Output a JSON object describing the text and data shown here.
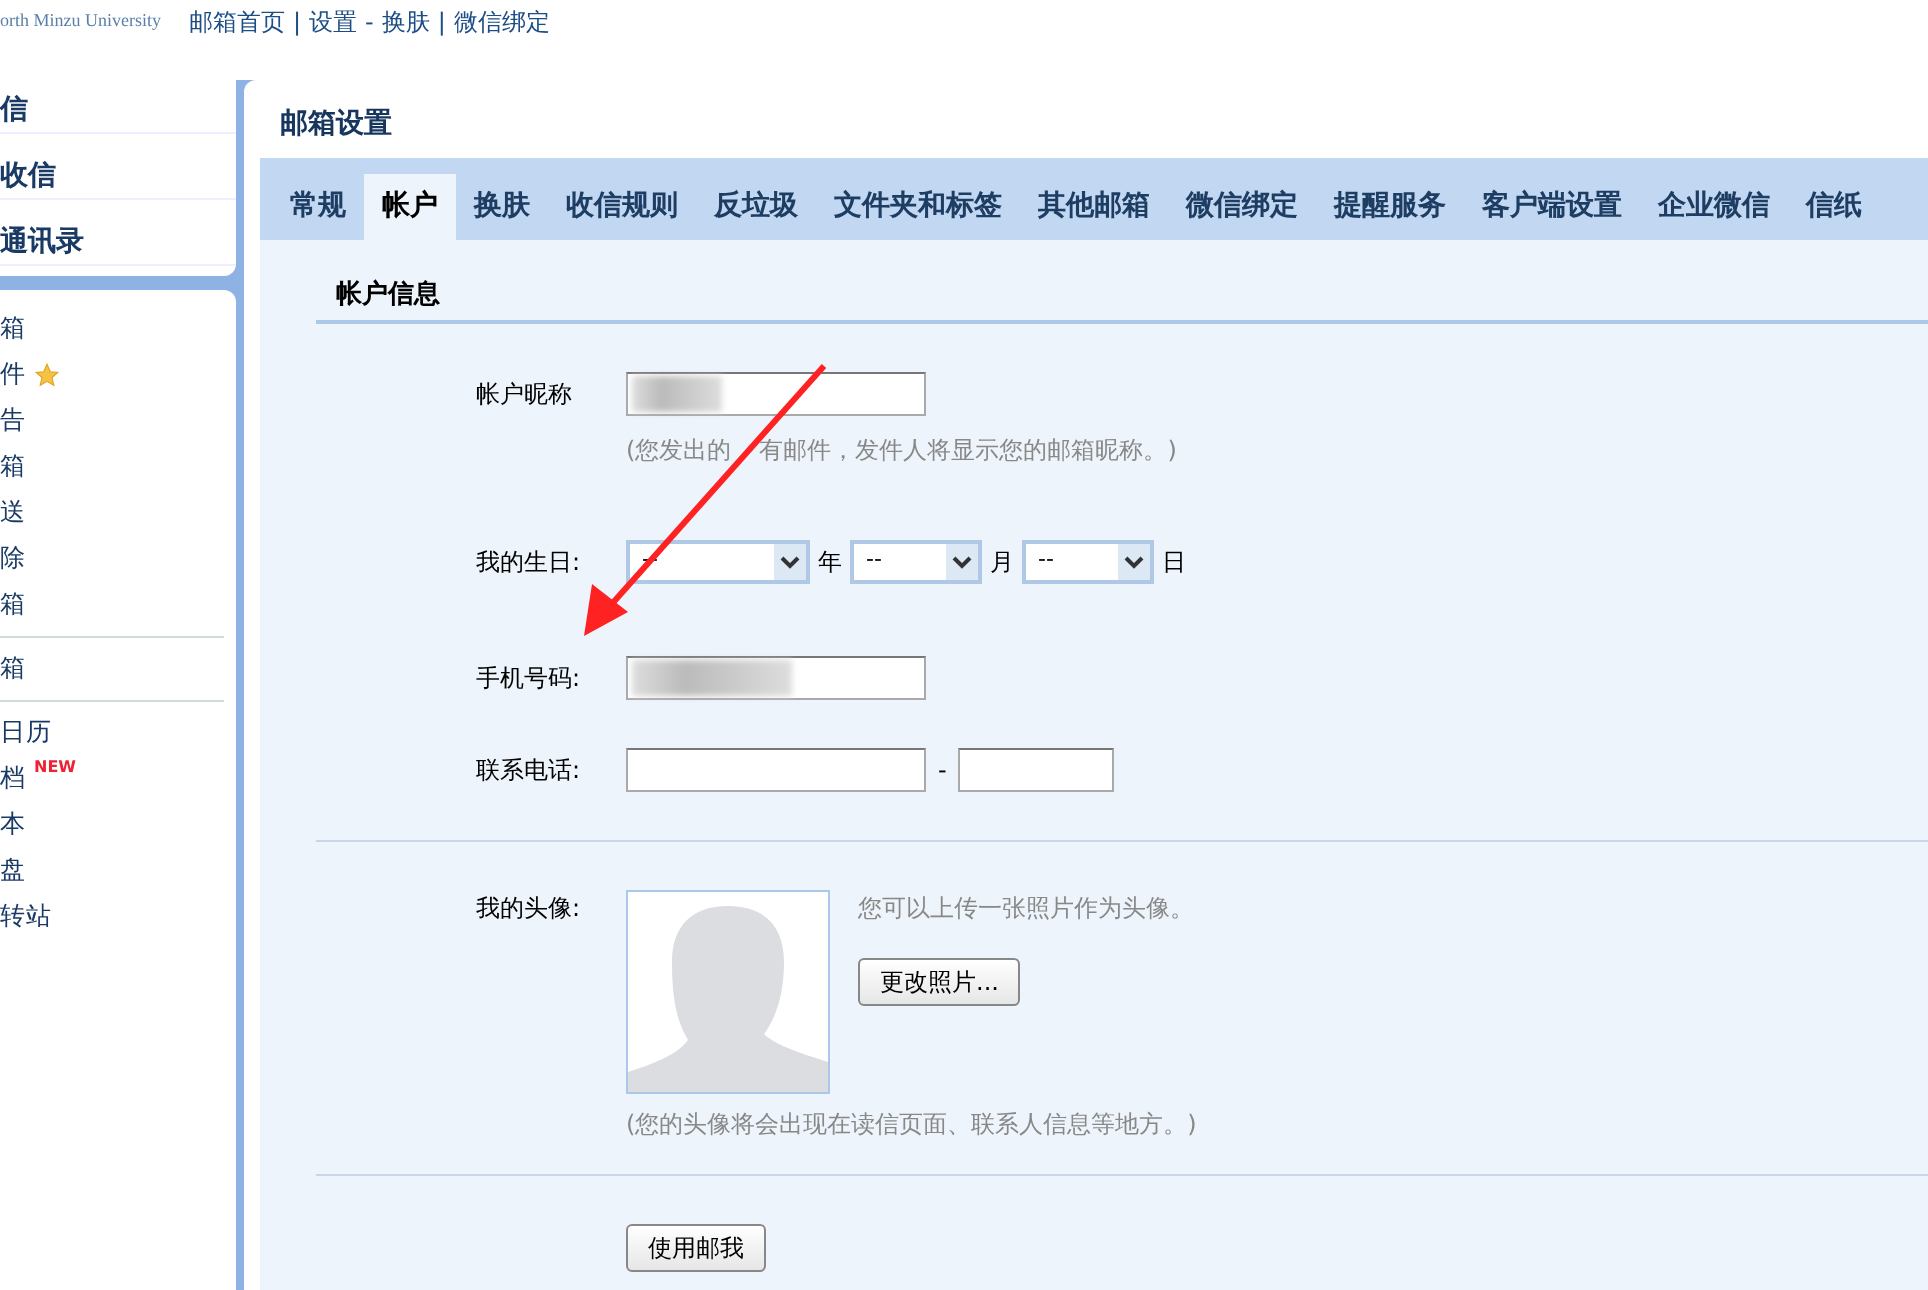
{
  "header": {
    "logo_subtitle": "orth Minzu University",
    "links": [
      {
        "label": "邮箱首页"
      },
      {
        "sep": "|"
      },
      {
        "label": "设置"
      },
      {
        "sep": "-"
      },
      {
        "label": "换肤"
      },
      {
        "sep": "|"
      },
      {
        "label": "微信绑定"
      }
    ]
  },
  "quick_actions": [
    "信",
    "收信",
    "通讯录"
  ],
  "sidebar": {
    "groups": [
      [
        {
          "label": "箱"
        },
        {
          "label": "件",
          "starred": true
        },
        {
          "label": "告"
        },
        {
          "label": "箱"
        },
        {
          "label": "送"
        },
        {
          "label": "除"
        },
        {
          "label": "箱"
        }
      ],
      [
        {
          "label": "箱"
        }
      ],
      [
        {
          "label": "日历"
        },
        {
          "label": "档",
          "badge": "NEW"
        },
        {
          "label": "本"
        },
        {
          "label": "盘"
        },
        {
          "label": "转站"
        }
      ]
    ]
  },
  "settings": {
    "title": "邮箱设置",
    "tabs": [
      {
        "label": "常规",
        "selected": false
      },
      {
        "label": "帐户",
        "selected": true
      },
      {
        "label": "换肤",
        "selected": false
      },
      {
        "label": "收信规则",
        "selected": false
      },
      {
        "label": "反垃圾",
        "selected": false
      },
      {
        "label": "文件夹和标签",
        "selected": false
      },
      {
        "label": "其他邮箱",
        "selected": false
      },
      {
        "label": "微信绑定",
        "selected": false
      },
      {
        "label": "提醒服务",
        "selected": false
      },
      {
        "label": "客户端设置",
        "selected": false
      },
      {
        "label": "企业微信",
        "selected": false
      },
      {
        "label": "信纸",
        "selected": false
      }
    ],
    "section_title": "帐户信息",
    "nickname": {
      "label": "帐户昵称",
      "hint_parts": [
        "(您发出的",
        "有邮件，发件人将显示您的邮箱昵称。)"
      ]
    },
    "birthday": {
      "label": "我的生日:",
      "selects": [
        {
          "value": "--",
          "unit": "年"
        },
        {
          "value": "--",
          "unit": "月"
        },
        {
          "value": "--",
          "unit": "日"
        }
      ]
    },
    "mobile": {
      "label": "手机号码:"
    },
    "phone": {
      "label": "联系电话:",
      "separator": "-"
    },
    "avatar": {
      "label": "我的头像:",
      "upload_hint": "您可以上传一张照片作为头像。",
      "change_button": "更改照片...",
      "note": "(您的头像将会出现在读信页面、联系人信息等地方。)"
    },
    "submit_button": "使用邮我"
  }
}
